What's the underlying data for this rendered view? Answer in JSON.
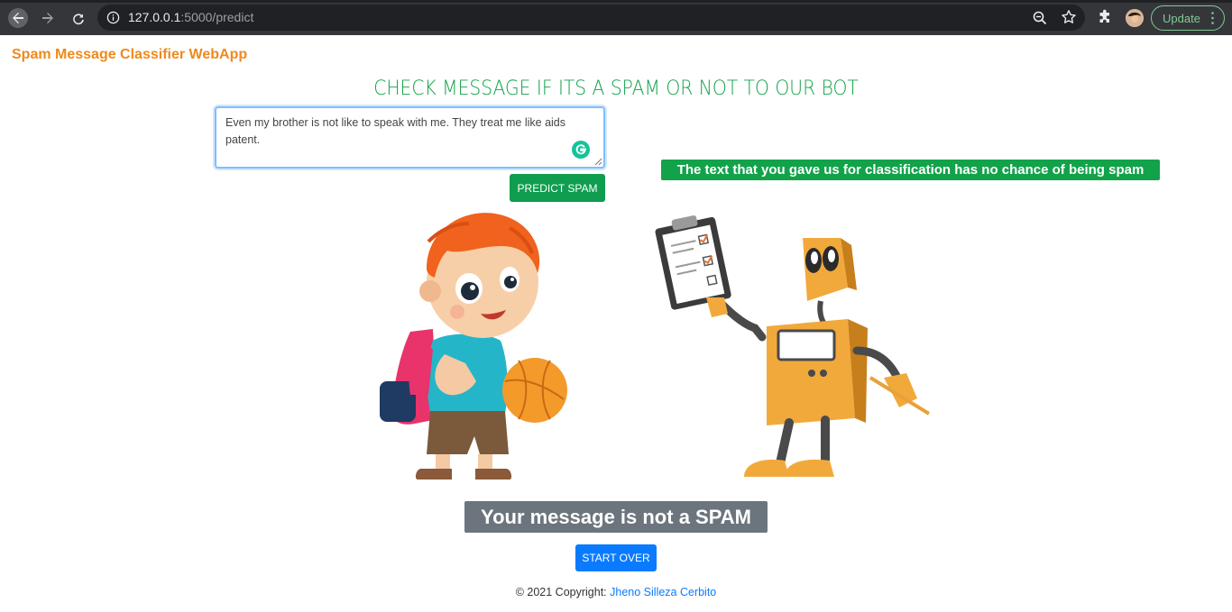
{
  "browser": {
    "url_host": "127.0.0.1",
    "url_path": ":5000/predict",
    "update_label": "Update",
    "icons": [
      "back-icon",
      "forward-icon",
      "reload-icon",
      "info-icon",
      "zoom-icon",
      "star-icon",
      "extensions-icon",
      "kebab-menu-icon"
    ]
  },
  "app": {
    "brand": "Spam Message Classifier WebApp",
    "headline": "CHECK MESSAGE IF ITS A SPAM OR NOT TO OUR BOT",
    "message_value": "Even my brother is not like to speak with me. They treat me like aids patent.",
    "predict_label": "PREDICT SPAM",
    "result_text": "The text that you gave us for classification has no chance of being spam",
    "verdict_text": "Your message is not a SPAM",
    "start_over_label": "START OVER"
  },
  "footer": {
    "prefix": "© 2021 Copyright: ",
    "author": "Jheno Silleza Cerbito"
  },
  "colors": {
    "brand": "#f0891b",
    "headline": "#12a24a",
    "predict_button": "#0f9d4f",
    "result_badge": "#12a24a",
    "verdict_badge": "#6c757d",
    "start_over_button": "#0a7bff",
    "author_link": "#0a7bff"
  }
}
